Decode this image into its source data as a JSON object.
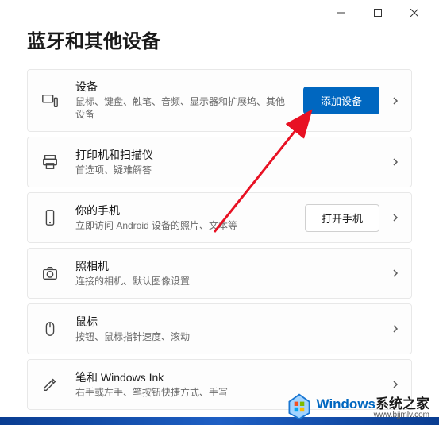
{
  "window": {
    "title": "蓝牙和其他设备"
  },
  "cards": {
    "devices": {
      "title": "设备",
      "sub": "鼠标、键盘、触笔、音频、显示器和扩展坞、其他设备",
      "action": "添加设备"
    },
    "printers": {
      "title": "打印机和扫描仪",
      "sub": "首选项、疑难解答"
    },
    "phone": {
      "title": "你的手机",
      "sub": "立即访问 Android 设备的照片、文本等",
      "action": "打开手机"
    },
    "camera": {
      "title": "照相机",
      "sub": "连接的相机、默认图像设置"
    },
    "mouse": {
      "title": "鼠标",
      "sub": "按钮、鼠标指针速度、滚动"
    },
    "pen": {
      "title": "笔和 Windows Ink",
      "sub": "右手或左手、笔按钮快捷方式、手写"
    }
  },
  "watermark": {
    "brand": "Windows",
    "suffix": "系统之家",
    "url": "www.bjjmlv.com"
  }
}
